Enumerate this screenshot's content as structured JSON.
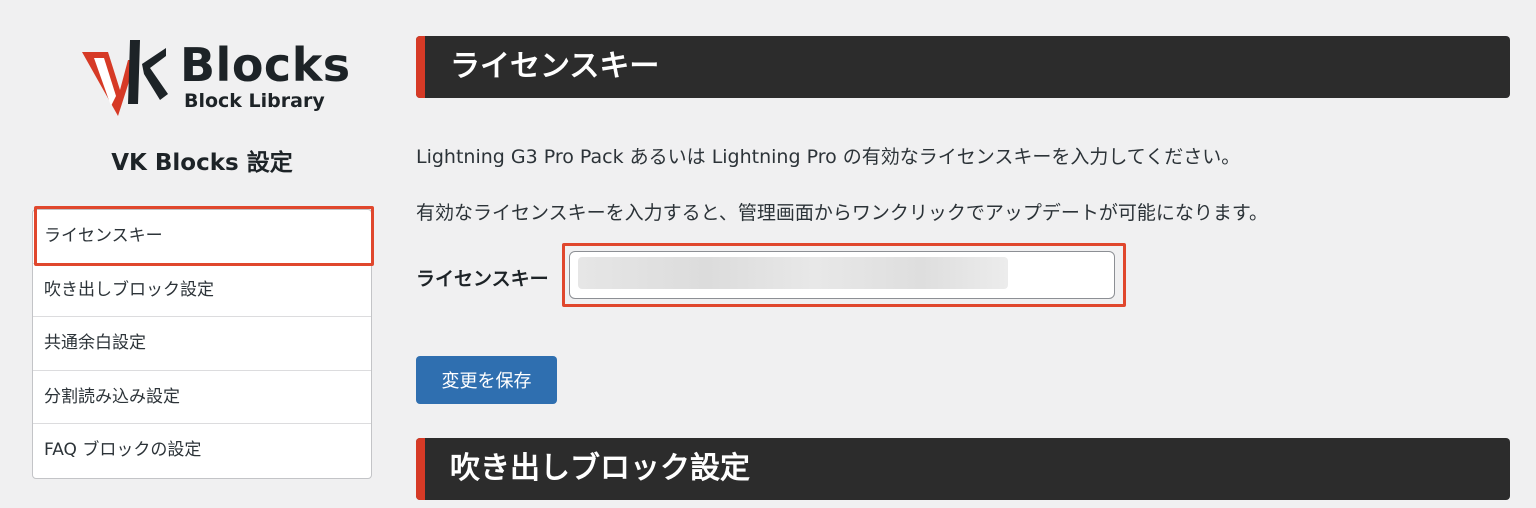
{
  "brand": {
    "logo_text": "Blocks",
    "logo_subtext": "Block Library",
    "accent_color": "#d63a26"
  },
  "sidebar": {
    "title": "VK Blocks 設定",
    "items": [
      {
        "label": "ライセンスキー"
      },
      {
        "label": "吹き出しブロック設定"
      },
      {
        "label": "共通余白設定"
      },
      {
        "label": "分割読み込み設定"
      },
      {
        "label": "FAQ ブロックの設定"
      }
    ]
  },
  "main": {
    "license_section": {
      "heading": "ライセンスキー",
      "description_1": "Lightning G3 Pro Pack あるいは Lightning Pro の有効なライセンスキーを入力してください。",
      "description_2": "有効なライセンスキーを入力すると、管理画面からワンクリックでアップデートが可能になります。",
      "field_label": "ライセンスキー",
      "field_value": ""
    },
    "save_button": "変更を保存",
    "balloon_section": {
      "heading": "吹き出しブロック設定"
    }
  }
}
